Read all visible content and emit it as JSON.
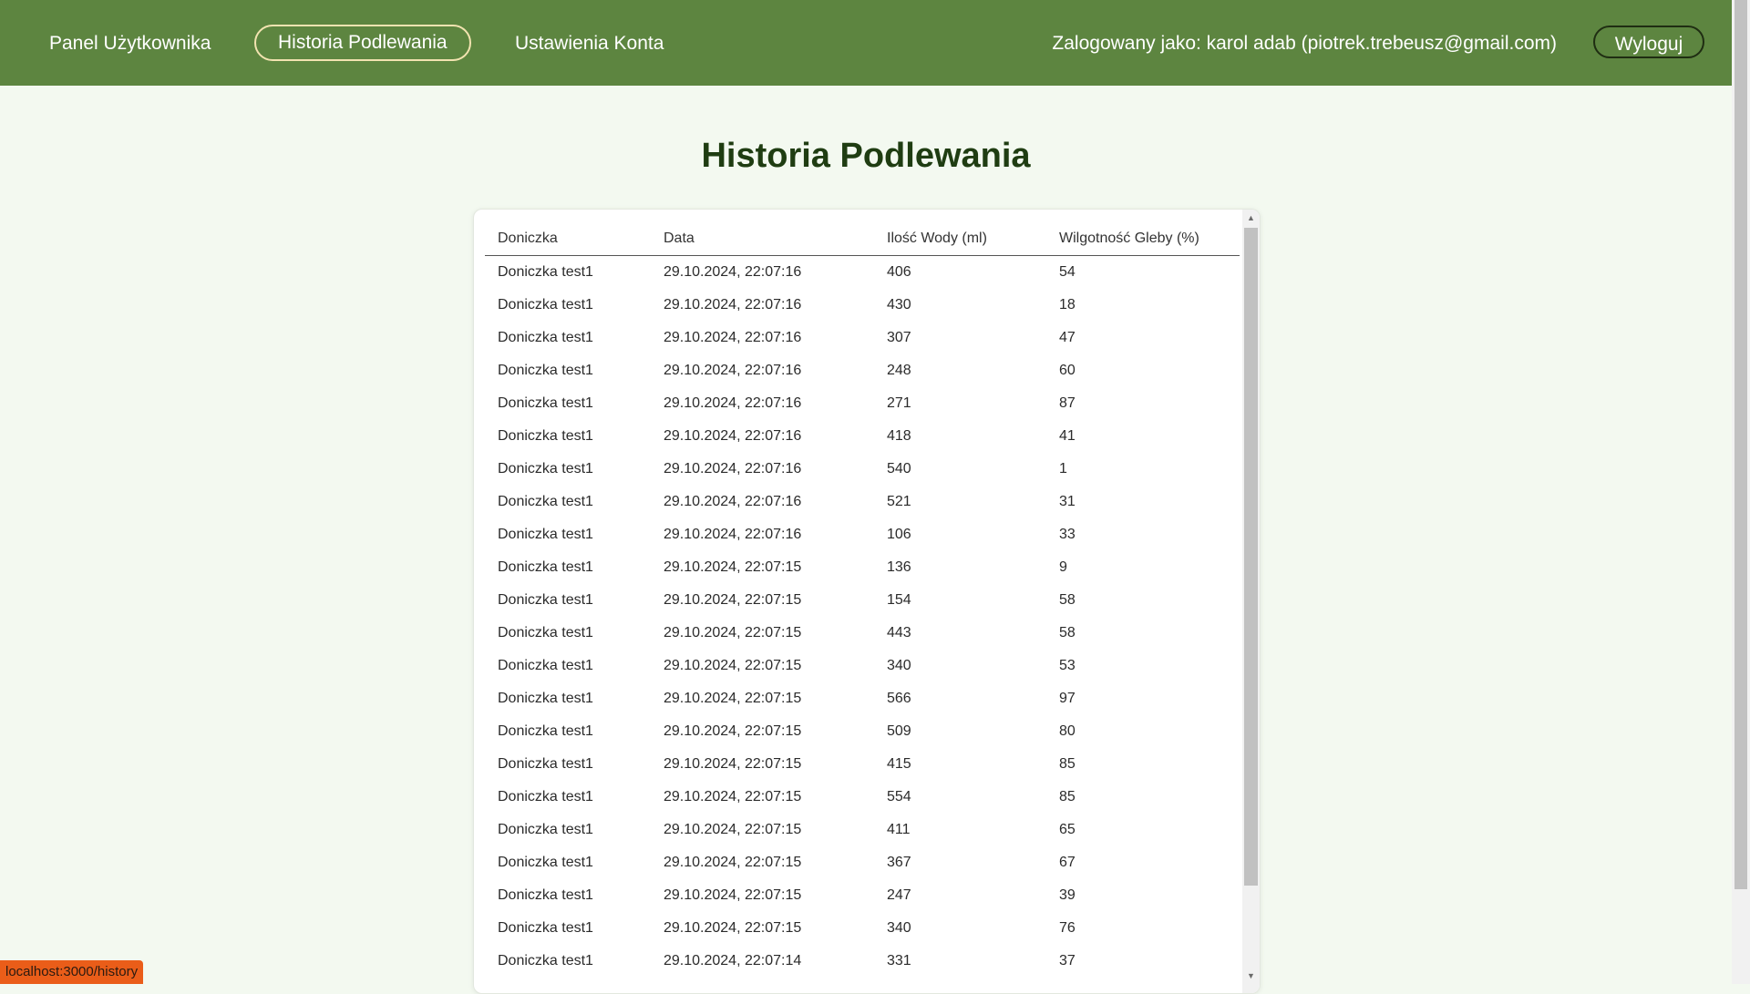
{
  "nav": {
    "links": [
      "Panel Użytkownika",
      "Historia Podlewania",
      "Ustawienia Konta"
    ],
    "user_info": "Zalogowany jako: karol adab (piotrek.trebeusz@gmail.com)",
    "logout_label": "Wyloguj"
  },
  "page": {
    "title": "Historia Podlewania"
  },
  "table": {
    "headers": [
      "Doniczka",
      "Data",
      "Ilość Wody (ml)",
      "Wilgotność Gleby (%)"
    ],
    "rows": [
      [
        "Doniczka test1",
        "29.10.2024, 22:07:16",
        "406",
        "54"
      ],
      [
        "Doniczka test1",
        "29.10.2024, 22:07:16",
        "430",
        "18"
      ],
      [
        "Doniczka test1",
        "29.10.2024, 22:07:16",
        "307",
        "47"
      ],
      [
        "Doniczka test1",
        "29.10.2024, 22:07:16",
        "248",
        "60"
      ],
      [
        "Doniczka test1",
        "29.10.2024, 22:07:16",
        "271",
        "87"
      ],
      [
        "Doniczka test1",
        "29.10.2024, 22:07:16",
        "418",
        "41"
      ],
      [
        "Doniczka test1",
        "29.10.2024, 22:07:16",
        "540",
        "1"
      ],
      [
        "Doniczka test1",
        "29.10.2024, 22:07:16",
        "521",
        "31"
      ],
      [
        "Doniczka test1",
        "29.10.2024, 22:07:16",
        "106",
        "33"
      ],
      [
        "Doniczka test1",
        "29.10.2024, 22:07:15",
        "136",
        "9"
      ],
      [
        "Doniczka test1",
        "29.10.2024, 22:07:15",
        "154",
        "58"
      ],
      [
        "Doniczka test1",
        "29.10.2024, 22:07:15",
        "443",
        "58"
      ],
      [
        "Doniczka test1",
        "29.10.2024, 22:07:15",
        "340",
        "53"
      ],
      [
        "Doniczka test1",
        "29.10.2024, 22:07:15",
        "566",
        "97"
      ],
      [
        "Doniczka test1",
        "29.10.2024, 22:07:15",
        "509",
        "80"
      ],
      [
        "Doniczka test1",
        "29.10.2024, 22:07:15",
        "415",
        "85"
      ],
      [
        "Doniczka test1",
        "29.10.2024, 22:07:15",
        "554",
        "85"
      ],
      [
        "Doniczka test1",
        "29.10.2024, 22:07:15",
        "411",
        "65"
      ],
      [
        "Doniczka test1",
        "29.10.2024, 22:07:15",
        "367",
        "67"
      ],
      [
        "Doniczka test1",
        "29.10.2024, 22:07:15",
        "247",
        "39"
      ],
      [
        "Doniczka test1",
        "29.10.2024, 22:07:15",
        "340",
        "76"
      ],
      [
        "Doniczka test1",
        "29.10.2024, 22:07:14",
        "331",
        "37"
      ]
    ]
  },
  "status_bar": {
    "url": "localhost:3000/history"
  },
  "colors": {
    "navbar": "#5d8540",
    "background": "#f3f9f0",
    "title": "#1f3d12",
    "status": "#ea5d19"
  }
}
